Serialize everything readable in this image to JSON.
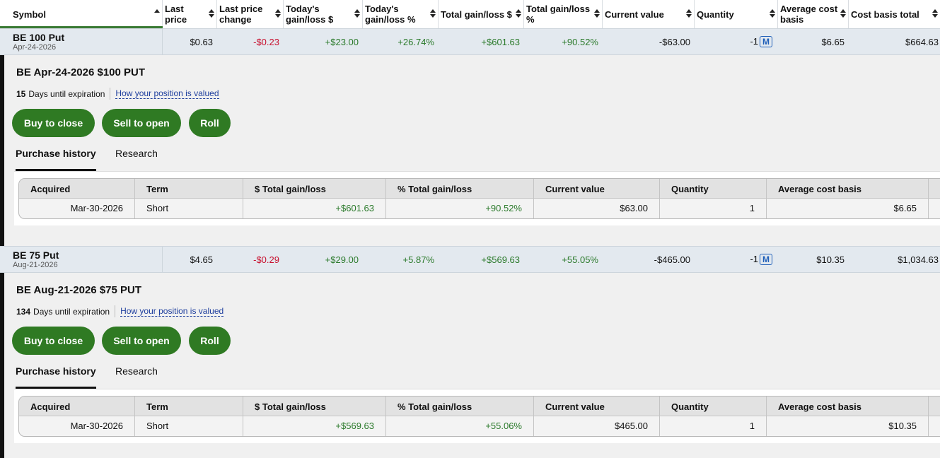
{
  "header": {
    "columns": [
      {
        "label": "Symbol"
      },
      {
        "label": "Last price"
      },
      {
        "label": "Last price change"
      },
      {
        "label": "Today's gain/loss $"
      },
      {
        "label": "Today's gain/loss %"
      },
      {
        "label": "Total gain/loss $"
      },
      {
        "label": "Total gain/loss %"
      },
      {
        "label": "Current value"
      },
      {
        "label": "Quantity"
      },
      {
        "label": "Average cost basis"
      },
      {
        "label": "Cost basis total"
      }
    ]
  },
  "positions": [
    {
      "symbol": "BE 100 Put",
      "expiry_date": "Apr-24-2026",
      "last_price": "$0.63",
      "last_price_change": "-$0.23",
      "todays_gain_dollar": "+$23.00",
      "todays_gain_pct": "+26.74%",
      "total_gain_dollar": "+$601.63",
      "total_gain_pct": "+90.52%",
      "current_value": "-$63.00",
      "quantity": "-1",
      "margin_badge": "M",
      "avg_cost_basis": "$6.65",
      "cost_basis_total": "$664.63",
      "detail": {
        "title": "BE Apr-24-2026 $100 PUT",
        "days_count": "15",
        "days_label": "Days until expiration",
        "valuation_link": "How your position is valued",
        "buttons": {
          "buy_to_close": "Buy to close",
          "sell_to_open": "Sell to open",
          "roll": "Roll"
        },
        "tabs": {
          "purchase_history": "Purchase history",
          "research": "Research"
        },
        "history_headers": [
          "Acquired",
          "Term",
          "$ Total gain/loss",
          "% Total gain/loss",
          "Current value",
          "Quantity",
          "Average cost basis"
        ],
        "history_row": {
          "acquired": "Mar-30-2026",
          "term": "Short",
          "total_gain_dollar": "+$601.63",
          "total_gain_pct": "+90.52%",
          "current_value": "$63.00",
          "quantity": "1",
          "avg_cost_basis": "$6.65"
        }
      }
    },
    {
      "symbol": "BE 75 Put",
      "expiry_date": "Aug-21-2026",
      "last_price": "$4.65",
      "last_price_change": "-$0.29",
      "todays_gain_dollar": "+$29.00",
      "todays_gain_pct": "+5.87%",
      "total_gain_dollar": "+$569.63",
      "total_gain_pct": "+55.05%",
      "current_value": "-$465.00",
      "quantity": "-1",
      "margin_badge": "M",
      "avg_cost_basis": "$10.35",
      "cost_basis_total": "$1,034.63",
      "detail": {
        "title": "BE Aug-21-2026 $75 PUT",
        "days_count": "134",
        "days_label": "Days until expiration",
        "valuation_link": "How your position is valued",
        "buttons": {
          "buy_to_close": "Buy to close",
          "sell_to_open": "Sell to open",
          "roll": "Roll"
        },
        "tabs": {
          "purchase_history": "Purchase history",
          "research": "Research"
        },
        "history_headers": [
          "Acquired",
          "Term",
          "$ Total gain/loss",
          "% Total gain/loss",
          "Current value",
          "Quantity",
          "Average cost basis"
        ],
        "history_row": {
          "acquired": "Mar-30-2026",
          "term": "Short",
          "total_gain_dollar": "+$569.63",
          "total_gain_pct": "+55.06%",
          "current_value": "$465.00",
          "quantity": "1",
          "avg_cost_basis": "$10.35"
        }
      }
    }
  ],
  "colors": {
    "accent_green": "#2f7a23",
    "gain_green": "#2b7a2b",
    "loss_red": "#c8102e",
    "link_blue": "#1f3f9e"
  }
}
